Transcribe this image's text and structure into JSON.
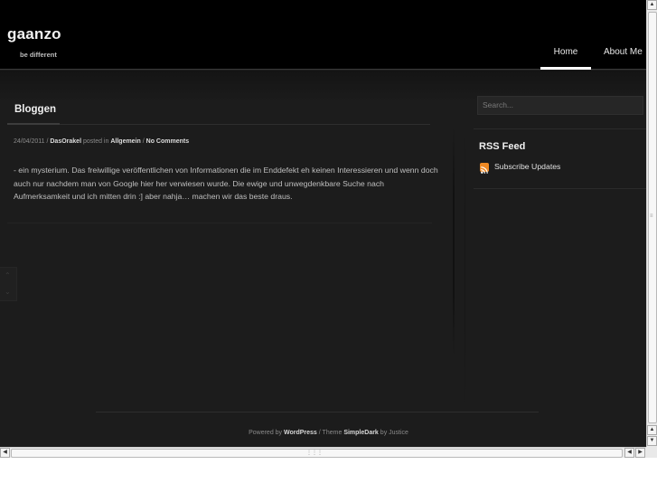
{
  "header": {
    "site_title": "gaanzo",
    "tagline": "be different",
    "nav": [
      {
        "label": "Home",
        "active": true
      },
      {
        "label": "About Me",
        "active": false
      }
    ]
  },
  "post": {
    "title": "Bloggen",
    "date": "24/04/2011",
    "sep1": "/",
    "author": "DasOrakel",
    "posted_in": "posted in",
    "category": "Allgemein",
    "sep2": "/",
    "comments": "No Comments",
    "body": "- ein mysterium. Das freiwillige veröffentlichen von Informationen die im Enddefekt eh keinen Interessieren und wenn doch auch nur nachdem man von Google hier her verwiesen wurde. Die ewige und unwegdenkbare Suche nach Aufmerksamkeit und ich mitten drin :] aber nahja… machen wir das beste draus."
  },
  "sidebar": {
    "search_placeholder": "Search...",
    "rss_heading": "RSS Feed",
    "subscribe_label": "Subscribe Updates",
    "rss_icon": "rss-icon"
  },
  "footer": {
    "powered_by": "Powered by",
    "wordpress": "WordPress",
    "theme_prefix": "/ Theme",
    "theme": "SimpleDark",
    "by": "by Justice"
  },
  "colors": {
    "background": "#1c1c1c",
    "header": "#000000",
    "rss_orange": "#f08a24"
  }
}
